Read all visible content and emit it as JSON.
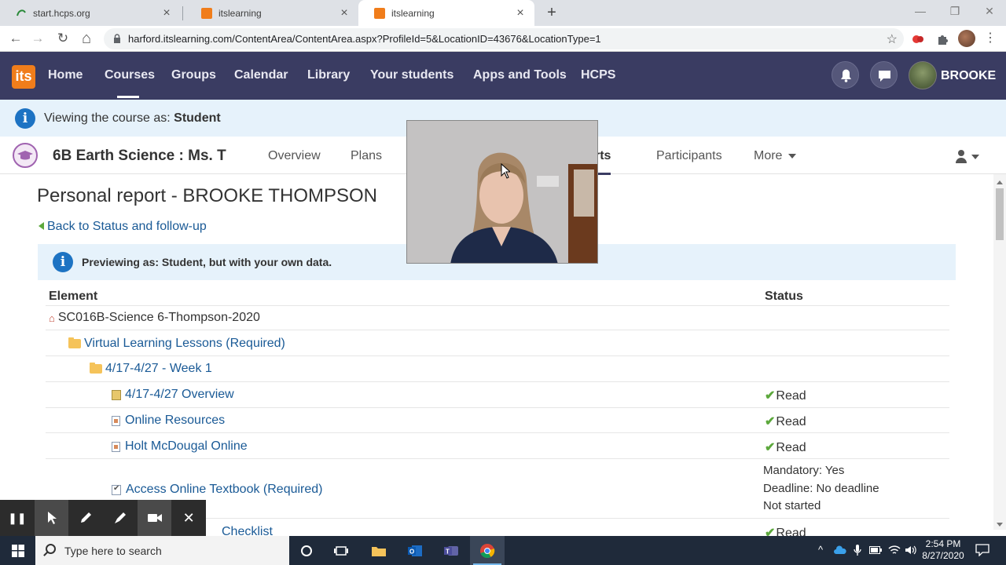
{
  "browser": {
    "tabs": [
      {
        "title": "start.hcps.org",
        "close": "×"
      },
      {
        "title": "itslearning",
        "close": "×"
      },
      {
        "title": "itslearning",
        "close": "×"
      }
    ],
    "new_tab": "+",
    "window": {
      "minimize": "—",
      "maximize": "❐",
      "close": "✕"
    },
    "url": "harford.itslearning.com/ContentArea/ContentArea.aspx?ProfileId=5&LocationID=43676&LocationType=1",
    "nav": {
      "back": "←",
      "forward": "→",
      "reload": "↻",
      "home": "⌂",
      "bookmark": "☆",
      "menu": "⋮"
    }
  },
  "site": {
    "logo": "its",
    "nav": [
      "Home",
      "Courses",
      "Groups",
      "Calendar",
      "Library",
      "Your students",
      "Apps and Tools",
      "HCPS"
    ],
    "user": "BROOKE"
  },
  "banner": {
    "prefix": "Viewing the course as: ",
    "role": "Student"
  },
  "course": {
    "title": "6B Earth Science : Ms. T",
    "tabs": [
      "Overview",
      "Plans",
      "Reports",
      "Participants",
      "More"
    ]
  },
  "report": {
    "title": "Personal report - BROOKE THOMPSON",
    "back_link": "Back to Status and follow-up",
    "preview_text": "Previewing as: Student, but with your own data.",
    "columns": {
      "element": "Element",
      "status": "Status"
    },
    "rows": [
      {
        "label": "SC016B-Science 6-Thompson-2020",
        "status": ""
      },
      {
        "label": "Virtual Learning Lessons (Required)",
        "status": ""
      },
      {
        "label": "4/17-4/27 - Week 1",
        "status": ""
      },
      {
        "label": "4/17-4/27 Overview",
        "status": "Read"
      },
      {
        "label": "Online Resources",
        "status": "Read"
      },
      {
        "label": "Holt McDougal Online",
        "status": "Read"
      },
      {
        "label": "Access Online Textbook (Required)",
        "status": ""
      },
      {
        "label": "Checklist",
        "status": "Read"
      }
    ],
    "task_status": [
      "Mandatory: Yes",
      "Deadline: No deadline",
      "Not started"
    ]
  },
  "recorder": {
    "pause": "❚❚",
    "close": "✕"
  },
  "taskbar": {
    "search_placeholder": "Type here to search",
    "time": "2:54 PM",
    "date": "8/27/2020"
  },
  "colors": {
    "nav_bg": "#3a3c62",
    "brand_orange": "#f07d1b",
    "info_blue": "#1d73c3",
    "link_blue": "#1a5a96",
    "check_green": "#5ca83c"
  }
}
